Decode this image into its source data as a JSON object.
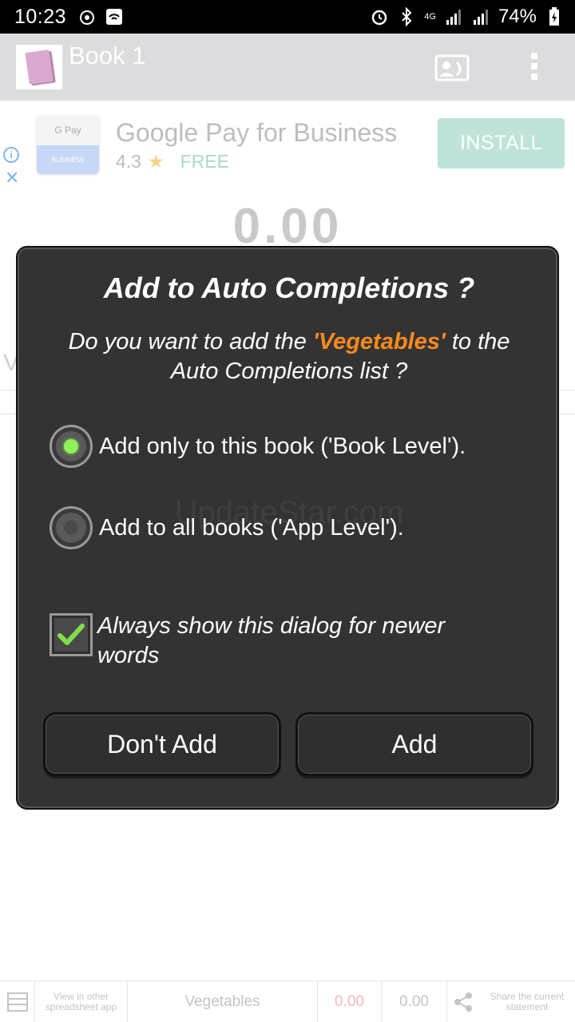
{
  "status_bar": {
    "time": "10:23",
    "battery": "74%",
    "network": "4G"
  },
  "app_bar": {
    "title": "Book 1"
  },
  "ad": {
    "title": "Google Pay for Business",
    "rating": "4.3",
    "price": "FREE",
    "install_label": "INSTALL",
    "icon_top_text": "G Pay",
    "icon_bottom_text": "BUSINESS"
  },
  "background": {
    "total": "0.00",
    "partial_letter": "V"
  },
  "dialog": {
    "title": "Add to Auto Completions ?",
    "message_before": "Do you want to add the ",
    "highlight": "'Vegetables'",
    "message_after": " to the Auto Completions list ?",
    "options": [
      {
        "label": "Add only to this book ('Book Level').",
        "selected": true
      },
      {
        "label": "Add to all books ('App Level').",
        "selected": false
      }
    ],
    "checkbox_label": "Always show this dialog for newer words",
    "checkbox_checked": true,
    "dont_add_label": "Don't Add",
    "add_label": "Add",
    "watermark": "UpdateStar.com"
  },
  "bottom_bar": {
    "view_other": "View in other spreadsheet app",
    "item": "Vegetables",
    "value1": "0.00",
    "value2": "0.00",
    "share": "Share the current statement"
  },
  "colors": {
    "highlight": "#ff8a1e",
    "radio_on": "#8ff05a",
    "install_bg": "#bfe3d8"
  }
}
